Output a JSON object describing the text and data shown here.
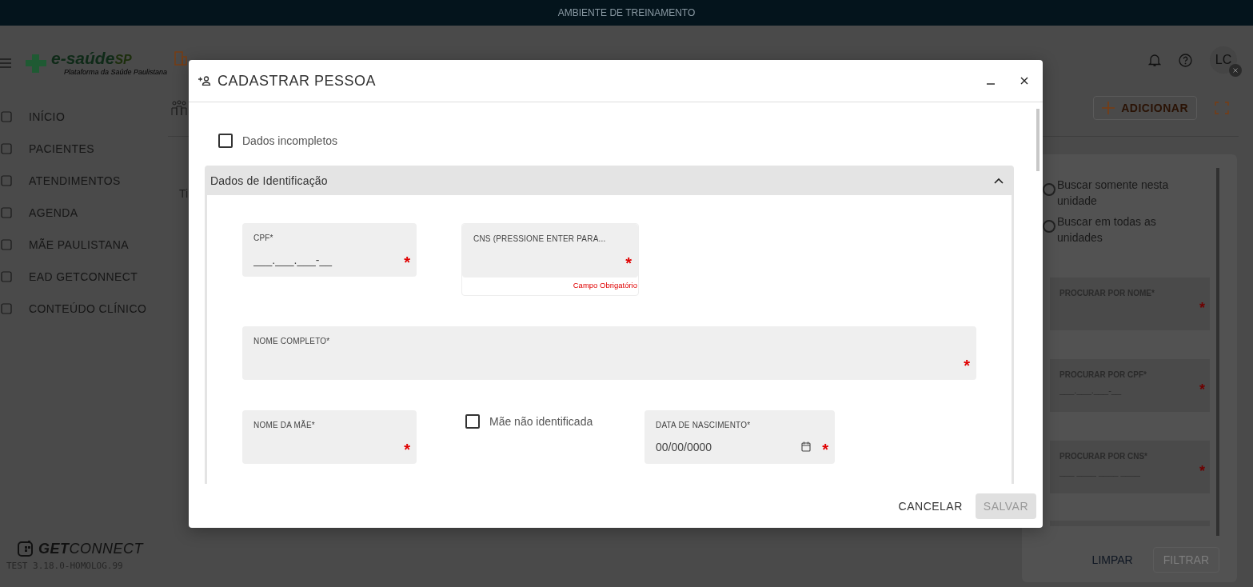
{
  "banner": "AMBIENTE DE TREINAMENTO",
  "header": {
    "logo_main": "e-saúde",
    "logo_accent": "SP",
    "logo_subtitle": "Plataforma da Saúde Paulistana",
    "avatar": "LC"
  },
  "sidebar": {
    "items": [
      "INÍCIO",
      "PACIENTES",
      "ATENDIMENTOS",
      "AGENDA",
      "MÃE PAULISTANA",
      "EAD GETCONNECT",
      "CONTEÚDO CLÍNICO"
    ],
    "brand": "**GET**CONNECT",
    "version": "TEST 3.18.0-HOMOLOG.99"
  },
  "page": {
    "tab_text": "Ti",
    "add_button": "ADICIONAR"
  },
  "filter": {
    "radios": [
      {
        "label": "Buscar somente nesta unidade",
        "selected": false
      },
      {
        "label": "Buscar em todas as unidades",
        "selected": false
      }
    ],
    "fields": [
      {
        "label": "PROCURAR POR NOME*",
        "required_mark": "*"
      },
      {
        "label": "PROCURAR POR CPF*",
        "placeholder": "___.___.___-__",
        "required_mark": "*"
      },
      {
        "label": "PROCURAR POR CNS*",
        "placeholder": "___ ____ ____ ____",
        "required_mark": "*"
      }
    ],
    "buttons": [
      {
        "label": "LIMPAR",
        "disabled": false
      },
      {
        "label": "FILTRAR",
        "disabled": true
      }
    ]
  },
  "modal": {
    "title": "CADASTRAR PESSOA",
    "incomplete": {
      "label": "Dados incompletos",
      "checked": false
    },
    "section": {
      "title": "Dados de Identificação",
      "expanded": true
    },
    "rows": [
      [
        {
          "kind": "text",
          "label": "CPF*",
          "placeholder": "___.___.___-__",
          "required_mark": "*"
        },
        {
          "kind": "text",
          "label": "CNS (PRESSIONE ENTER PARA...",
          "required_mark": "*",
          "error": "Campo Obrigatório"
        }
      ],
      [
        {
          "kind": "text",
          "label": "NOME COMPLETO*",
          "required_mark": "*"
        }
      ],
      [
        {
          "kind": "text",
          "label": "NOME DA MÃE*",
          "required_mark": "*"
        },
        {
          "kind": "checkbox",
          "label": "Mãe não identificada",
          "checked": false
        },
        {
          "kind": "date",
          "label": "DATA DE NASCIMENTO*",
          "placeholder": "00/00/0000",
          "required_mark": "*"
        }
      ]
    ],
    "buttons": [
      {
        "label": "CANCELAR",
        "disabled": false
      },
      {
        "label": "SALVAR",
        "disabled": true
      }
    ]
  }
}
